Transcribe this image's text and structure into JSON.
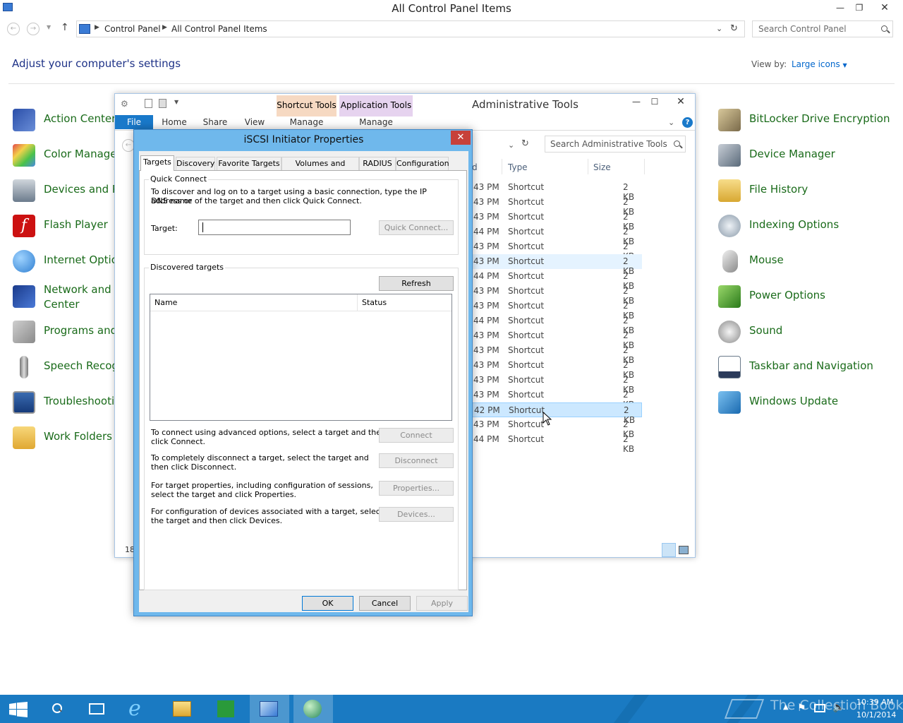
{
  "control_panel": {
    "title": "All Control Panel Items",
    "breadcrumb": [
      "Control Panel",
      "All Control Panel Items"
    ],
    "search_placeholder": "Search Control Panel",
    "heading": "Adjust your computer's settings",
    "view_by_label": "View by:",
    "view_by_value": "Large icons",
    "items_left": [
      {
        "label": "Action Center",
        "icon": "flag-icon",
        "color": "#1f3f8a"
      },
      {
        "label": "Color Manage",
        "icon": "color-management-icon",
        "color": "#4aa3df"
      },
      {
        "label": "Devices and Pr",
        "icon": "printer-icon",
        "color": "#6b7b8c"
      },
      {
        "label": "Flash Player",
        "icon": "flash-icon",
        "color": "#cc1111"
      },
      {
        "label": "Internet Optio",
        "icon": "globe-icon",
        "color": "#2f7fd1"
      },
      {
        "label": "Network and S",
        "label2": "Center",
        "icon": "network-icon",
        "color": "#2b5aa8"
      },
      {
        "label": "Programs and",
        "icon": "programs-icon",
        "color": "#8a8a8a"
      },
      {
        "label": "Speech Recogn",
        "icon": "microphone-icon",
        "color": "#9a9a9a"
      },
      {
        "label": "Troubleshootin",
        "icon": "troubleshoot-icon",
        "color": "#2a5b9a"
      },
      {
        "label": "Work Folders",
        "icon": "folder-icon",
        "color": "#e8b84a"
      }
    ],
    "items_right": [
      {
        "label": "BitLocker Drive Encryption",
        "icon": "bitlocker-icon",
        "color": "#9a8a6a"
      },
      {
        "label": "Device Manager",
        "icon": "device-manager-icon",
        "color": "#7a8a9a"
      },
      {
        "label": "File History",
        "icon": "file-history-icon",
        "color": "#e8c04a"
      },
      {
        "label": "Indexing Options",
        "icon": "indexing-icon",
        "color": "#8a9aaa"
      },
      {
        "label": "Mouse",
        "icon": "mouse-icon",
        "color": "#b0b0b0"
      },
      {
        "label": "Power Options",
        "icon": "power-icon",
        "color": "#4a9a3a"
      },
      {
        "label": "Sound",
        "icon": "speaker-icon",
        "color": "#a0a0a0"
      },
      {
        "label": "Taskbar and Navigation",
        "icon": "taskbar-icon",
        "color": "#3a4a6a"
      },
      {
        "label": "Windows Update",
        "icon": "windows-update-icon",
        "color": "#3a8ad0"
      }
    ]
  },
  "admin_tools": {
    "title": "Administrative Tools",
    "context_tabs": [
      {
        "label": "Shortcut Tools",
        "color": "#f6d9c2"
      },
      {
        "label": "Application Tools",
        "color": "#e6d3ef"
      }
    ],
    "ribbon_tabs": [
      "File",
      "Home",
      "Share",
      "View",
      "Manage",
      "Manage"
    ],
    "search_placeholder": "Search Administrative Tools",
    "columns": [
      "d",
      "Type",
      "Size"
    ],
    "rows": [
      {
        "date": "43 PM",
        "type": "Shortcut",
        "size": "2 KB"
      },
      {
        "date": "43 PM",
        "type": "Shortcut",
        "size": "2 KB"
      },
      {
        "date": "43 PM",
        "type": "Shortcut",
        "size": "2 KB"
      },
      {
        "date": "44 PM",
        "type": "Shortcut",
        "size": "2 KB"
      },
      {
        "date": "43 PM",
        "type": "Shortcut",
        "size": "2 KB"
      },
      {
        "date": "43 PM",
        "type": "Shortcut",
        "size": "2 KB",
        "state": "hover"
      },
      {
        "date": "44 PM",
        "type": "Shortcut",
        "size": "2 KB"
      },
      {
        "date": "43 PM",
        "type": "Shortcut",
        "size": "2 KB"
      },
      {
        "date": "43 PM",
        "type": "Shortcut",
        "size": "2 KB"
      },
      {
        "date": "44 PM",
        "type": "Shortcut",
        "size": "2 KB"
      },
      {
        "date": "43 PM",
        "type": "Shortcut",
        "size": "2 KB"
      },
      {
        "date": "43 PM",
        "type": "Shortcut",
        "size": "2 KB"
      },
      {
        "date": "43 PM",
        "type": "Shortcut",
        "size": "2 KB"
      },
      {
        "date": "43 PM",
        "type": "Shortcut",
        "size": "2 KB"
      },
      {
        "date": "43 PM",
        "type": "Shortcut",
        "size": "2 KB"
      },
      {
        "date": "42 PM",
        "type": "Shortcut",
        "size": "2 KB",
        "state": "selected"
      },
      {
        "date": "43 PM",
        "type": "Shortcut",
        "size": "2 KB"
      },
      {
        "date": "44 PM",
        "type": "Shortcut",
        "size": "2 KB"
      }
    ],
    "status_count": "18"
  },
  "iscsi": {
    "title": "iSCSI Initiator Properties",
    "tabs": [
      "Targets",
      "Discovery",
      "Favorite Targets",
      "Volumes and Devices",
      "RADIUS",
      "Configuration"
    ],
    "quick_connect": {
      "group_title": "Quick Connect",
      "description_line1": "To discover and log on to a target using a basic connection, type the IP address or",
      "description_line2": "DNS name of the target and then click Quick Connect.",
      "target_label": "Target:",
      "target_value": "",
      "button": "Quick Connect..."
    },
    "discovered": {
      "group_title": "Discovered targets",
      "refresh_button": "Refresh",
      "columns": [
        "Name",
        "Status"
      ]
    },
    "actions": [
      {
        "line1": "To connect using advanced options, select a target and then",
        "line2": "click Connect.",
        "button": "Connect"
      },
      {
        "line1": "To completely disconnect a target, select the target and",
        "line2": "then click Disconnect.",
        "button": "Disconnect"
      },
      {
        "line1": "For target properties, including configuration of sessions,",
        "line2": "select the target and click Properties.",
        "button": "Properties..."
      },
      {
        "line1": "For configuration of devices associated with a target, select",
        "line2": "the target and then click Devices.",
        "button": "Devices..."
      }
    ],
    "footer": {
      "ok": "OK",
      "cancel": "Cancel",
      "apply": "Apply"
    }
  },
  "taskbar": {
    "time": "10:39 AM",
    "date": "10/1/2014",
    "watermark": "The Collection Book",
    "accent": "#1a7ac2"
  }
}
